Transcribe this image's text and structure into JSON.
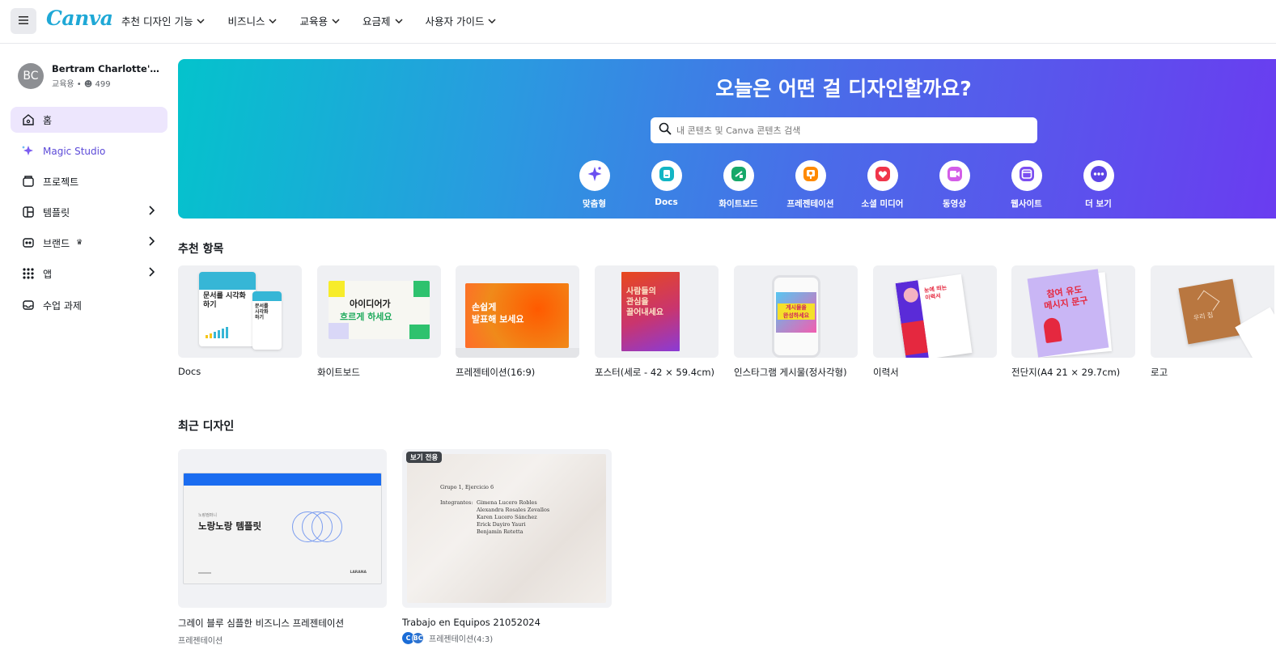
{
  "header": {
    "logo": "Canva",
    "nav": [
      "추천 디자인 기능",
      "비즈니스",
      "교육용",
      "요금제",
      "사용자 가이드"
    ]
  },
  "account": {
    "initials": "BC",
    "name": "Bertram Charlotte's Cl...",
    "plan": "교육용",
    "members": "499"
  },
  "sidebar": {
    "items": [
      {
        "label": "홈",
        "icon": "home-icon"
      },
      {
        "label": "Magic Studio",
        "icon": "sparkle-icon"
      },
      {
        "label": "프로젝트",
        "icon": "folder-icon"
      },
      {
        "label": "템플릿",
        "icon": "template-icon"
      },
      {
        "label": "브랜드",
        "icon": "brand-icon"
      },
      {
        "label": "앱",
        "icon": "apps-grid-icon"
      },
      {
        "label": "수업 과제",
        "icon": "inbox-icon"
      }
    ]
  },
  "hero": {
    "title": "오늘은 어떤 걸 디자인할까요?",
    "search_placeholder": "내 콘텐츠 및 Canva 콘텐츠 검색",
    "categories": [
      {
        "label": "맞춤형",
        "icon": "sparkle-icon",
        "color": "#6a4ff0"
      },
      {
        "label": "Docs",
        "icon": "docs-icon",
        "color": "#13b5c4"
      },
      {
        "label": "화이트보드",
        "icon": "whiteboard-icon",
        "color": "#17a86a"
      },
      {
        "label": "프레젠테이션",
        "icon": "presentation-icon",
        "color": "#ff8a00"
      },
      {
        "label": "소셜 미디어",
        "icon": "heart-icon",
        "color": "#f0354a"
      },
      {
        "label": "동영상",
        "icon": "video-icon",
        "color": "#d35de8"
      },
      {
        "label": "웹사이트",
        "icon": "website-icon",
        "color": "#7b4df0"
      },
      {
        "label": "더 보기",
        "icon": "more-icon",
        "color": "#5c44e6"
      }
    ]
  },
  "recommended": {
    "title": "추천 항목",
    "items": [
      {
        "label": "Docs",
        "thumb_text": "문서를 시각화하기"
      },
      {
        "label": "화이트보드",
        "thumb_text": "아이디어가 흐르게 하세요"
      },
      {
        "label": "프레젠테이션(16:9)",
        "thumb_text": "손쉽게 발표해 보세요"
      },
      {
        "label": "포스터(세로 - 42 × 59.4cm)",
        "thumb_text": "사람들의 관심을 끌어내세요"
      },
      {
        "label": "인스타그램 게시물(정사각형)",
        "thumb_text": "게시물을 완성하세요"
      },
      {
        "label": "이력서",
        "thumb_text": "눈에 띄는 이력서"
      },
      {
        "label": "전단지(A4 21 × 29.7cm)",
        "thumb_text": "참여 유도 메시지 문구"
      },
      {
        "label": "로고",
        "thumb_text": "우리 집"
      }
    ]
  },
  "recent": {
    "title": "최근 디자인",
    "items": [
      {
        "title": "그레이 블루 심플한 비즈니스 프레젠테이션",
        "type": "프레젠테이션",
        "thumb_heading": "노랑노랑 템플릿",
        "thumb_small": "노랑컴퍼니",
        "thumb_brand": "LARANA"
      },
      {
        "title": "Trabajo en Equipos 21052024",
        "type": "프레젠테이션(4:3)",
        "badge": "보기 전용",
        "thumb_lines": [
          "Grupo 1, Ejercicio 6",
          "Integrantes:",
          "Gimena Lucero Robles",
          "Alexandra Rosales Zevallos",
          "Karen Lucero Sánchez",
          "Erick Dayiro Yauri",
          "Benjamín Retetta"
        ],
        "owners": [
          "C",
          "BC"
        ]
      }
    ]
  }
}
